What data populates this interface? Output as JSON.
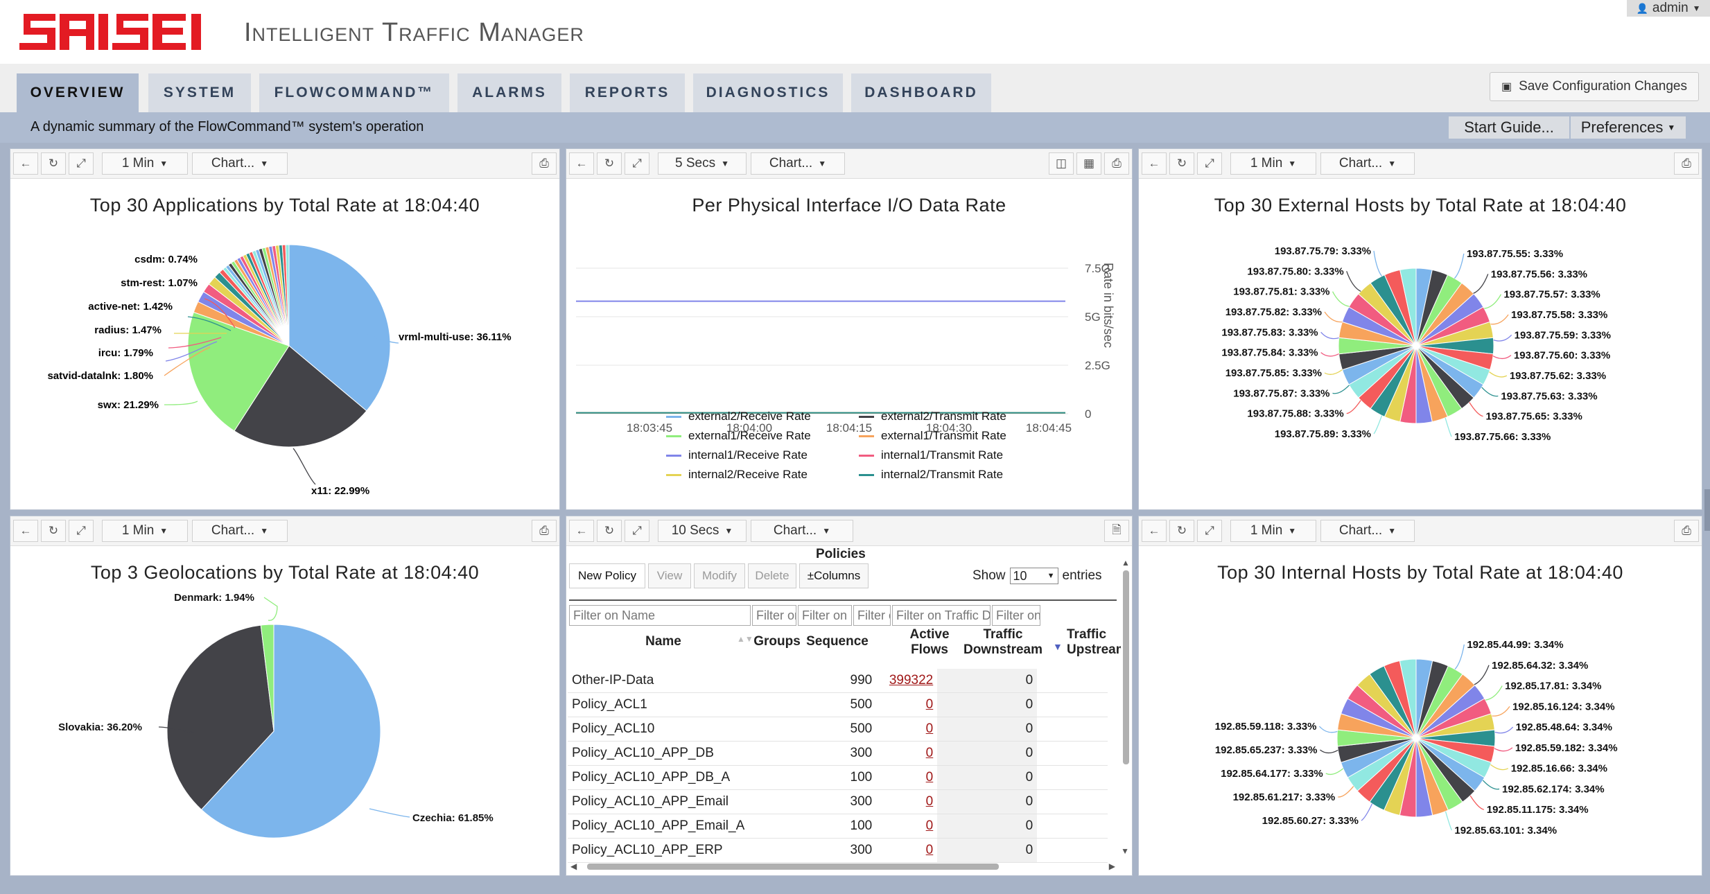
{
  "header": {
    "logo_text": "SAISEI",
    "app_title": "Intelligent Traffic Manager",
    "user": "admin"
  },
  "tabs": [
    "OVERVIEW",
    "SYSTEM",
    "FLOWCOMMAND™",
    "ALARMS",
    "REPORTS",
    "DIAGNOSTICS",
    "DASHBOARD"
  ],
  "save_label": "Save Configuration Changes",
  "subtitle": "A dynamic summary of the FlowCommand™ system's operation",
  "start_guide": "Start Guide...",
  "preferences": "Preferences",
  "colors": {
    "blue": "#7cb5ec",
    "dark": "#434348",
    "green": "#90ed7d",
    "orange": "#f7a35c",
    "purple": "#8085e9",
    "pink": "#f15c80",
    "yellow": "#e4d354",
    "teal": "#2b908f",
    "red": "#f45b5b",
    "cyan": "#91e8e1",
    "brand": "#e31b23"
  },
  "panels": {
    "apps": {
      "interval": "1 Min",
      "chart_menu": "Chart...",
      "title": "Top 30 Applications by Total Rate at 18:04:40"
    },
    "io": {
      "interval": "5 Secs",
      "chart_menu": "Chart...",
      "title": "Per Physical Interface I/O Data Rate",
      "y_axis_label": "Rate in bits/sec",
      "y_ticks": [
        "7.5G",
        "5G",
        "2.5G",
        "0"
      ],
      "x_ticks": [
        "18:03:45",
        "18:04:00",
        "18:04:15",
        "18:04:30",
        "18:04:45"
      ],
      "legend": [
        "external2/Receive Rate",
        "external2/Transmit Rate",
        "external1/Receive Rate",
        "external1/Transmit Rate",
        "internal1/Receive Rate",
        "internal1/Transmit Rate",
        "internal2/Receive Rate",
        "internal2/Transmit Rate"
      ]
    },
    "ext": {
      "interval": "1 Min",
      "chart_menu": "Chart...",
      "title": "Top 30 External Hosts by Total Rate at 18:04:40"
    },
    "geo": {
      "interval": "1 Min",
      "chart_menu": "Chart...",
      "title": "Top 3 Geolocations by Total Rate at 18:04:40"
    },
    "policies": {
      "interval": "10 Secs",
      "chart_menu": "Chart...",
      "title": "Policies",
      "buttons": {
        "new": "New Policy",
        "view": "View",
        "modify": "Modify",
        "delete": "Delete",
        "columns": "±Columns"
      },
      "show_label": "Show",
      "show_value": "10",
      "entries_label": "entries",
      "filters": [
        "Filter on Name",
        "Filter on Groups",
        "Filter on Seq",
        "Filter on Active",
        "Filter on Traffic Downstream",
        "Filter on Traffic"
      ],
      "columns": [
        "Name",
        "Groups",
        "Sequence",
        "Active Flows",
        "Traffic Downstream",
        "Traffic Upstream"
      ],
      "rows": [
        {
          "name": "Other-IP-Data",
          "seq": "990",
          "flows": "399322",
          "down": "0"
        },
        {
          "name": "Policy_ACL1",
          "seq": "500",
          "flows": "0",
          "down": "0"
        },
        {
          "name": "Policy_ACL10",
          "seq": "500",
          "flows": "0",
          "down": "0"
        },
        {
          "name": "Policy_ACL10_APP_DB",
          "seq": "300",
          "flows": "0",
          "down": "0"
        },
        {
          "name": "Policy_ACL10_APP_DB_A",
          "seq": "100",
          "flows": "0",
          "down": "0"
        },
        {
          "name": "Policy_ACL10_APP_Email",
          "seq": "300",
          "flows": "0",
          "down": "0"
        },
        {
          "name": "Policy_ACL10_APP_Email_A",
          "seq": "100",
          "flows": "0",
          "down": "0"
        },
        {
          "name": "Policy_ACL10_APP_ERP",
          "seq": "300",
          "flows": "0",
          "down": "0"
        }
      ]
    },
    "int": {
      "interval": "1 Min",
      "chart_menu": "Chart...",
      "title": "Top 30 Internal Hosts by Total Rate at 18:04:40"
    }
  },
  "chart_data": [
    {
      "type": "pie",
      "title": "Top 30 Applications by Total Rate at 18:04:40",
      "labels": [
        "vrml-multi-use: 36.11%",
        "x11: 22.99%",
        "swx: 21.29%",
        "satvid-datalnk: 1.80%",
        "ircu: 1.79%",
        "radius: 1.47%",
        "active-net: 1.42%",
        "stm-rest: 1.07%",
        "csdm: 0.74%"
      ],
      "values": [
        36.11,
        22.99,
        21.29,
        1.8,
        1.79,
        1.47,
        1.42,
        1.07,
        0.74,
        11.32
      ]
    },
    {
      "type": "line",
      "title": "Per Physical Interface I/O Data Rate",
      "ylabel": "Rate in bits/sec",
      "x": [
        "18:03:40",
        "18:04:47"
      ],
      "ylim": [
        0,
        7.5
      ],
      "series": [
        {
          "name": "external2/Receive Rate",
          "values": [
            0.05,
            0.05
          ]
        },
        {
          "name": "external2/Transmit Rate",
          "values": [
            0.05,
            0.05
          ]
        },
        {
          "name": "external1/Receive Rate",
          "values": [
            0.05,
            0.05
          ]
        },
        {
          "name": "external1/Transmit Rate",
          "values": [
            0.05,
            0.05
          ]
        },
        {
          "name": "internal1/Receive Rate",
          "values": [
            5.8,
            5.8
          ]
        },
        {
          "name": "internal1/Transmit Rate",
          "values": [
            0.05,
            0.05
          ]
        },
        {
          "name": "internal2/Receive Rate",
          "values": [
            0.05,
            0.05
          ]
        },
        {
          "name": "internal2/Transmit Rate",
          "values": [
            0.05,
            0.05
          ]
        }
      ]
    },
    {
      "type": "pie",
      "title": "Top 30 External Hosts by Total Rate at 18:04:40",
      "labels": [
        "193.87.75.55: 3.33%",
        "193.87.75.56: 3.33%",
        "193.87.75.57: 3.33%",
        "193.87.75.58: 3.33%",
        "193.87.75.59: 3.33%",
        "193.87.75.60: 3.33%",
        "193.87.75.62: 3.33%",
        "193.87.75.63: 3.33%",
        "193.87.75.65: 3.33%",
        "193.87.75.66: 3.33%",
        "193.87.75.79: 3.33%",
        "193.87.75.80: 3.33%",
        "193.87.75.81: 3.33%",
        "193.87.75.82: 3.33%",
        "193.87.75.83: 3.33%",
        "193.87.75.84: 3.33%",
        "193.87.75.85: 3.33%",
        "193.87.75.87: 3.33%",
        "193.87.75.88: 3.33%",
        "193.87.75.89: 3.33%"
      ],
      "slices": 30
    },
    {
      "type": "pie",
      "title": "Top 3 Geolocations by Total Rate at 18:04:40",
      "labels": [
        "Czechia: 61.85%",
        "Slovakia: 36.20%",
        "Denmark: 1.94%"
      ],
      "values": [
        61.85,
        36.2,
        1.94
      ]
    },
    {
      "type": "pie",
      "title": "Top 30 Internal Hosts by Total Rate at 18:04:40",
      "labels": [
        "192.85.44.99: 3.34%",
        "192.85.64.32: 3.34%",
        "192.85.17.81: 3.34%",
        "192.85.16.124: 3.34%",
        "192.85.48.64: 3.34%",
        "192.85.59.182: 3.34%",
        "192.85.16.66: 3.34%",
        "192.85.62.174: 3.34%",
        "192.85.11.175: 3.34%",
        "192.85.63.101: 3.34%",
        "192.85.59.118: 3.33%",
        "192.85.65.237: 3.33%",
        "192.85.64.177: 3.33%",
        "192.85.61.217: 3.33%",
        "192.85.60.27: 3.33%"
      ],
      "slices": 30
    }
  ]
}
